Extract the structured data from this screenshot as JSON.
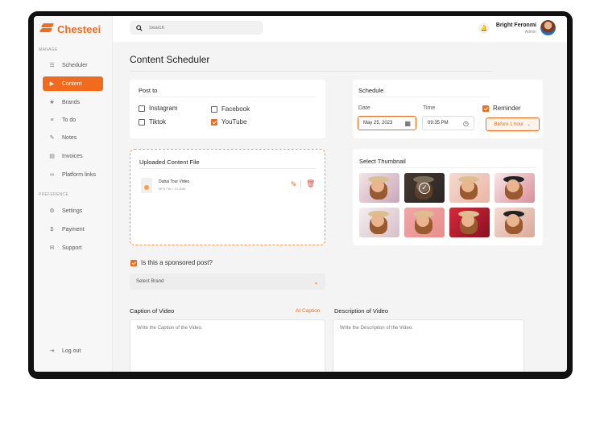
{
  "app": {
    "name": "Chesteei"
  },
  "sidebar": {
    "manage_label": "MANAGE",
    "preference_label": "PREFERENCE",
    "items": [
      {
        "label": "Scheduler",
        "icon": "list-icon"
      },
      {
        "label": "Content",
        "icon": "play-icon",
        "active": true
      },
      {
        "label": "Brands",
        "icon": "star-icon"
      },
      {
        "label": "To do",
        "icon": "checklist-icon"
      },
      {
        "label": "Notes",
        "icon": "notes-icon"
      },
      {
        "label": "Invoices",
        "icon": "invoice-icon"
      },
      {
        "label": "Platform links",
        "icon": "link-icon"
      }
    ],
    "pref_items": [
      {
        "label": "Settings",
        "icon": "gear-icon"
      },
      {
        "label": "Payment",
        "icon": "dollar-icon"
      },
      {
        "label": "Support",
        "icon": "support-icon"
      }
    ],
    "logout": "Log out"
  },
  "header": {
    "search_placeholder": "Search",
    "user_name": "Bright Feronmi",
    "user_role": "Admin"
  },
  "page": {
    "title": "Content Scheduler"
  },
  "post_to": {
    "title": "Post to",
    "options": [
      {
        "label": "Instagram",
        "checked": false
      },
      {
        "label": "Facebook",
        "checked": false
      },
      {
        "label": "Tiktok",
        "checked": false
      },
      {
        "label": "YouTube",
        "checked": true
      }
    ]
  },
  "schedule": {
    "title": "Schedule",
    "date_label": "Date",
    "date_value": "May 25, 2023",
    "time_label": "Time",
    "time_value": "09:35 PM",
    "reminder_label": "Reminder",
    "reminder_checked": true,
    "reminder_value": "Before 1 hour"
  },
  "upload": {
    "title": "Uploaded Content File",
    "file_name": "Dubai Tour Video",
    "file_meta": "MP4 File • 14.3MB"
  },
  "thumbnail": {
    "title": "Select Thumbnail",
    "selected_index": 1,
    "count": 8
  },
  "sponsored": {
    "label": "Is this a sponsored post?",
    "checked": true
  },
  "brand": {
    "placeholder": "Select Brand"
  },
  "caption": {
    "label": "Caption of Video",
    "ai_label": "AI Caption",
    "placeholder": "Write the Caption of the Video."
  },
  "description": {
    "label": "Description of Video",
    "placeholder": "Write the Description of the Video."
  },
  "colors": {
    "accent": "#f26b1d",
    "background": "#f4f4f5",
    "frame": "#111111"
  }
}
